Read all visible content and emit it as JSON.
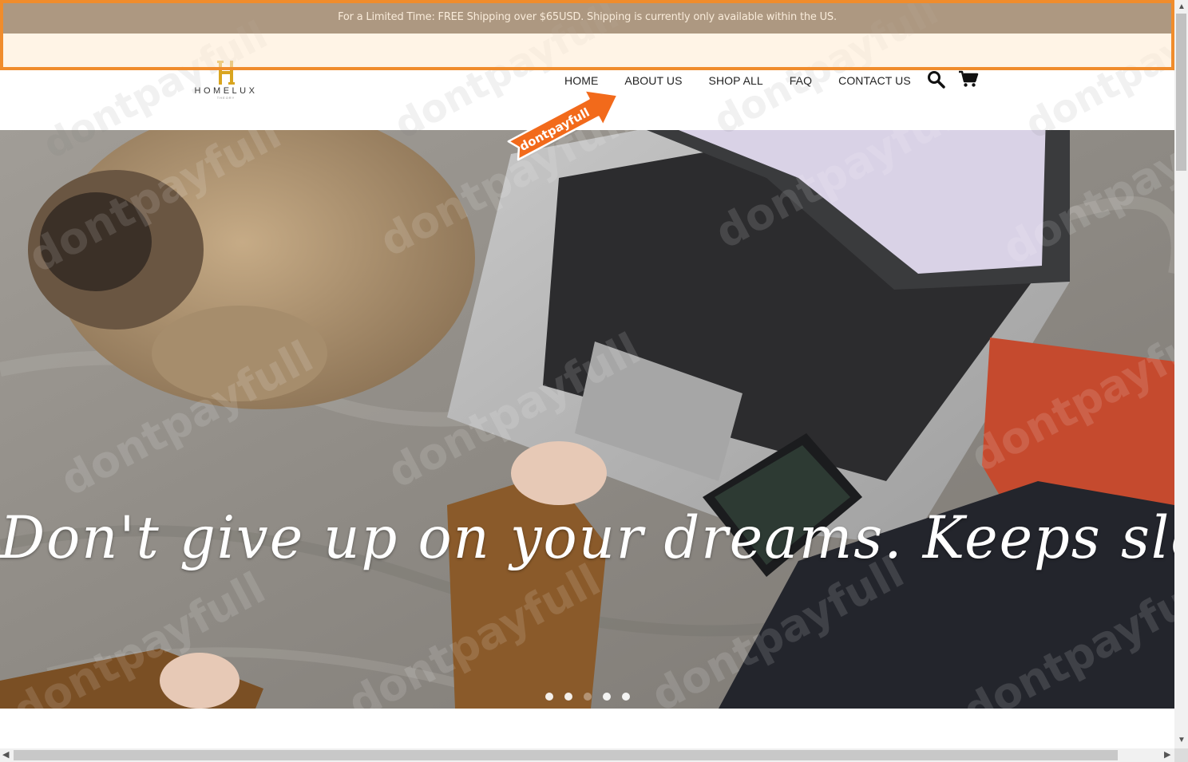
{
  "announcement": {
    "text": "For a Limited Time: FREE Shipping over $65USD. Shipping is currently only available within the US."
  },
  "logo": {
    "word": "HOMELUX",
    "sub": "THEORY",
    "color": "#d9a520"
  },
  "nav": {
    "items": [
      {
        "label": "HOME"
      },
      {
        "label": "ABOUT US"
      },
      {
        "label": "SHOP ALL"
      },
      {
        "label": "FAQ"
      },
      {
        "label": "CONTACT US"
      }
    ],
    "search_icon": "search-icon",
    "cart_icon": "cart-icon"
  },
  "promo_ribbon": {
    "text": "dontpayfull",
    "color": "#f26a1b"
  },
  "hero": {
    "caption": "Don't give up on your dreams. Keeps sleeping",
    "slides": 5,
    "active_slide": 3
  },
  "watermark": {
    "text": "dontpayfull"
  },
  "colors": {
    "announcement_bg": "#4a3420",
    "highlight_border": "#f08c2c"
  }
}
